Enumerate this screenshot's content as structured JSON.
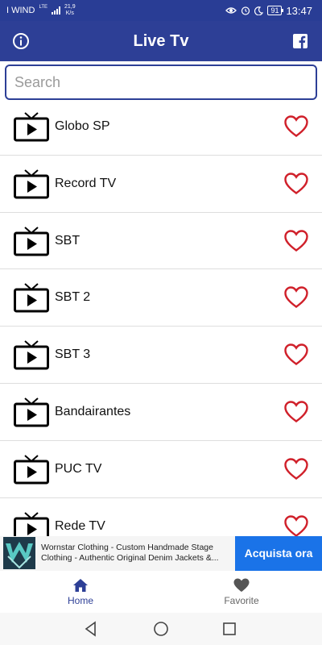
{
  "status_bar": {
    "carrier": "I WIND",
    "network": "LTE",
    "speed_value": "21,9",
    "speed_unit": "K/s",
    "battery": "91",
    "time": "13:47"
  },
  "app_bar": {
    "title": "Live Tv",
    "left_icon": "info-icon",
    "right_icon": "facebook-icon"
  },
  "search": {
    "placeholder": "Search",
    "value": ""
  },
  "channels": [
    {
      "name": "Globo SP",
      "favorite": false
    },
    {
      "name": "Record TV",
      "favorite": false
    },
    {
      "name": "SBT",
      "favorite": false
    },
    {
      "name": "SBT 2",
      "favorite": false
    },
    {
      "name": "SBT 3",
      "favorite": false
    },
    {
      "name": "Bandairantes",
      "favorite": false
    },
    {
      "name": "PUC TV",
      "favorite": false
    },
    {
      "name": "Rede TV",
      "favorite": false
    }
  ],
  "ad": {
    "line1": "Wornstar Clothing - Custom Handmade Stage",
    "line2": "Clothing - Authentic Original Denim Jackets &...",
    "cta": "Acquista ora"
  },
  "bottom_nav": {
    "home_label": "Home",
    "favorite_label": "Favorite",
    "active": "Home"
  },
  "colors": {
    "primary": "#2d3f96",
    "heart": "#d0202a",
    "ad_button": "#1a73e8"
  }
}
